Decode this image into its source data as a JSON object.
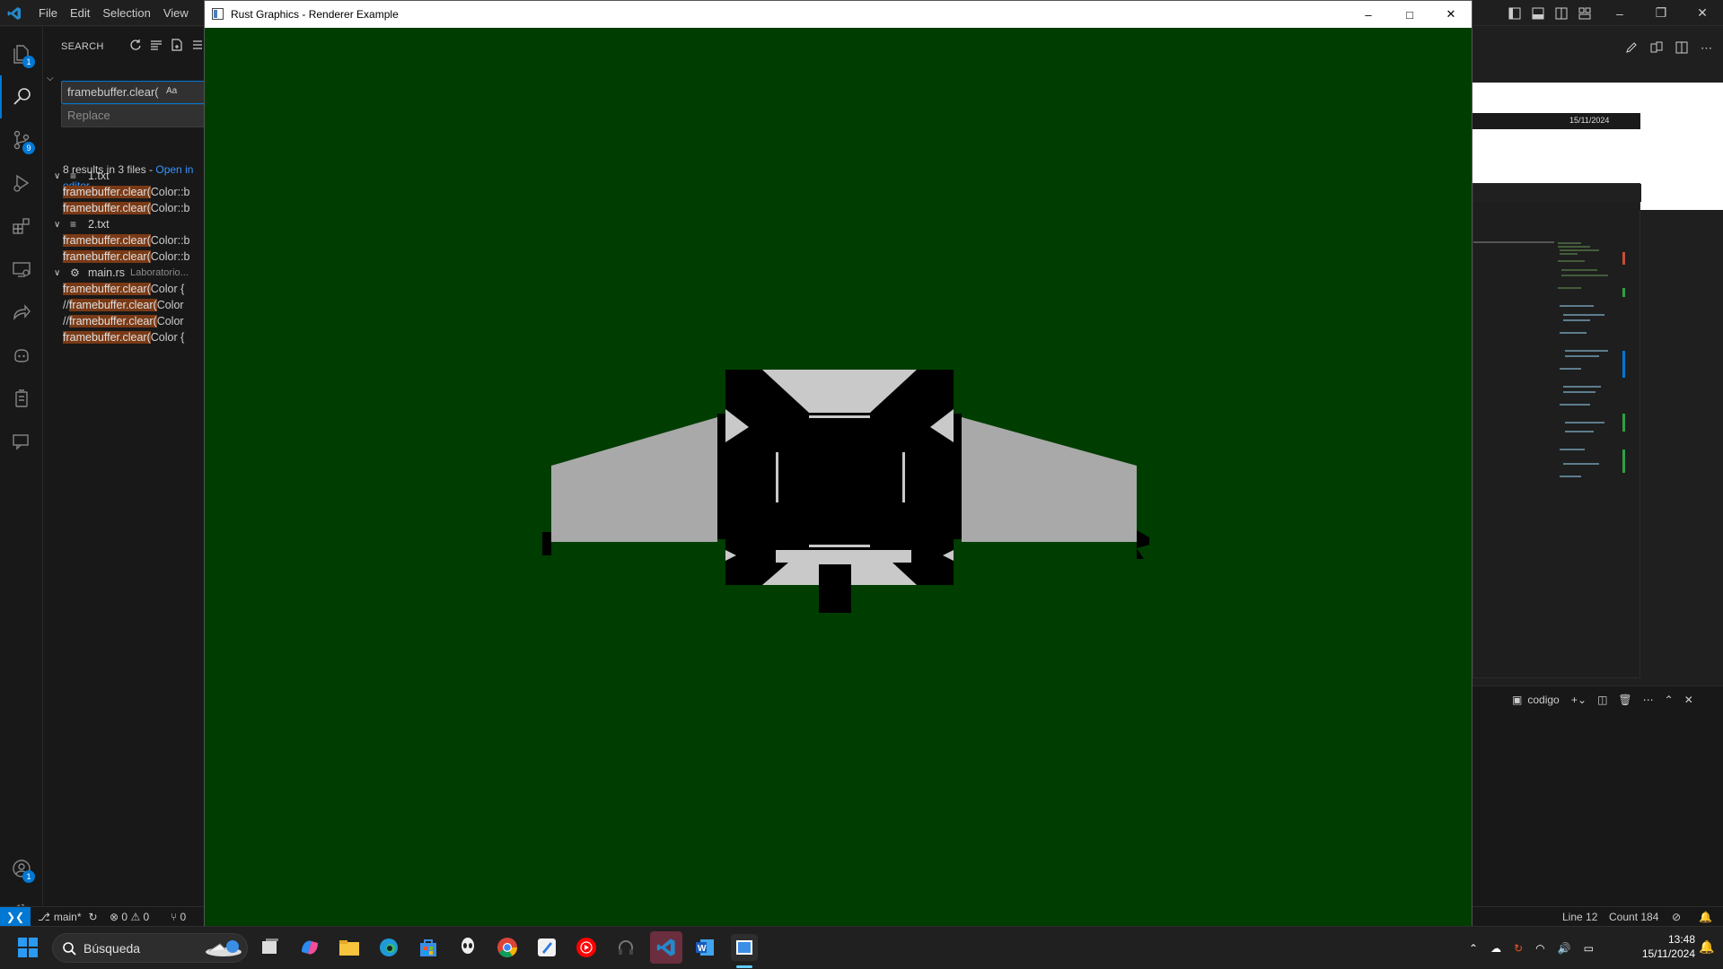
{
  "titlebar": {
    "menus": [
      "File",
      "Edit",
      "Selection",
      "View"
    ]
  },
  "activity": {
    "explorer_badge": "1",
    "scm_badge": "9",
    "accounts_badge": "1"
  },
  "search": {
    "header": "SEARCH",
    "query": "framebuffer.clear(",
    "case_toggle": "Aa",
    "replace_placeholder": "Replace",
    "summary": "8 results in 3 files - ",
    "open_link": "Open in editor",
    "files": [
      {
        "name": "1.txt",
        "path": "",
        "matches": [
          {
            "pre": "",
            "hit": "framebuffer.clear(",
            "post": "Color::b"
          },
          {
            "pre": "",
            "hit": "framebuffer.clear(",
            "post": "Color::b"
          }
        ]
      },
      {
        "name": "2.txt",
        "path": "",
        "matches": [
          {
            "pre": "",
            "hit": "framebuffer.clear(",
            "post": "Color::b"
          },
          {
            "pre": "",
            "hit": "framebuffer.clear(",
            "post": "Color::b"
          }
        ]
      },
      {
        "name": "main.rs",
        "path": "Laboratorio...",
        "matches": [
          {
            "pre": "",
            "hit": "framebuffer.clear(",
            "post": "Color {"
          },
          {
            "pre": "//",
            "hit": "framebuffer.clear(",
            "post": "Color"
          },
          {
            "pre": "//",
            "hit": "framebuffer.clear(",
            "post": "Color"
          },
          {
            "pre": "",
            "hit": "framebuffer.clear(",
            "post": "Color {"
          }
        ]
      }
    ]
  },
  "rust_window": {
    "title": "Rust Graphics - Renderer Example"
  },
  "right_pane": {
    "date_snippet": "15/11/2024",
    "terminal_label": "codigo"
  },
  "statusbar": {
    "branch": "main*",
    "errors": "0",
    "warnings": "0",
    "ports": "0",
    "line": "Line 12",
    "count": "Count 184"
  },
  "taskbar": {
    "search_label": "Búsqueda",
    "time": "13:48",
    "date": "15/11/2024"
  },
  "colors": {
    "canvas_bg": "#003d00",
    "ship_light": "#a9a9a9",
    "ship_dark": "#000000",
    "accent": "#0078d4",
    "match_highlight": "#7a3a16"
  }
}
